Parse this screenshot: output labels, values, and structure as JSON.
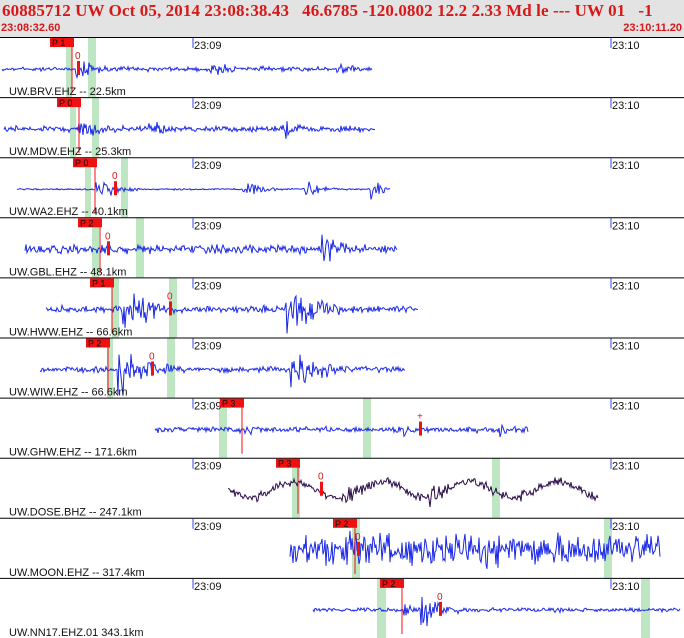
{
  "header": {
    "title": "60885712 UW Oct 05, 2014 23:08:38.43   46.6785 -120.0802 12.2 2.33 Md le --- UW 01   -1",
    "start_time": "23:08:32.60",
    "end_time": "23:10:11.20"
  },
  "time_axis": {
    "minute_labels": [
      "23:09",
      "23:10"
    ]
  },
  "colors": {
    "trace": "#1a28e6",
    "trace_alt": "#2a0c4a",
    "pick_box": "#ee1111",
    "pick_line": "#ee1111",
    "window_band": "#bfe6c3",
    "header_bg": "#e3e3e3",
    "header_text": "#d81818",
    "divider": "#000000",
    "tick": "#3344ee"
  },
  "stations": [
    {
      "label": "UW.BRV.EHZ -- 22.5km",
      "pick_label": "P 1",
      "mark": "0",
      "trace_color": "blue"
    },
    {
      "label": "UW.MDW.EHZ -- 25.3km",
      "pick_label": "P 0",
      "mark": "",
      "trace_color": "blue"
    },
    {
      "label": "UW.WA2.EHZ -- 40.1km",
      "pick_label": "P 0",
      "mark": "0",
      "trace_color": "blue"
    },
    {
      "label": "UW.GBL.EHZ -- 48.1km",
      "pick_label": "P 2",
      "mark": "0",
      "trace_color": "blue"
    },
    {
      "label": "UW.HWW.EHZ -- 66.6km",
      "pick_label": "P 1",
      "mark": "0",
      "trace_color": "blue"
    },
    {
      "label": "UW.WIW.EHZ -- 66.6km",
      "pick_label": "P 2",
      "mark": "0",
      "trace_color": "blue"
    },
    {
      "label": "UW.GHW.EHZ -- 171.6km",
      "pick_label": "P 3",
      "mark": "+",
      "trace_color": "blue"
    },
    {
      "label": "UW.DOSE.BHZ -- 247.1km",
      "pick_label": "P 3",
      "mark": "0",
      "trace_color": "dark"
    },
    {
      "label": "UW.MOON.EHZ -- 317.4km",
      "pick_label": "P 2",
      "mark": "0",
      "trace_color": "blue"
    },
    {
      "label": "UW.NN17.EHZ.01 343.1km",
      "pick_label": "P 2",
      "mark": "0",
      "trace_color": "blue"
    }
  ]
}
